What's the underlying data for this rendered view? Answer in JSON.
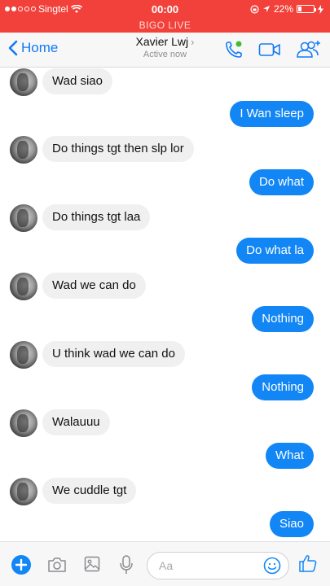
{
  "status_bar": {
    "carrier": "Singtel",
    "time": "00:00",
    "battery": "22%"
  },
  "live_banner": "BIGO LIVE",
  "nav": {
    "back_label": "Home",
    "contact_name": "Xavier Lwj",
    "status": "Active now"
  },
  "messages": [
    {
      "dir": "in",
      "text": "Wad siao"
    },
    {
      "dir": "out",
      "text": "I Wan sleep"
    },
    {
      "dir": "in",
      "text": "Do things tgt then slp lor"
    },
    {
      "dir": "out",
      "text": "Do what"
    },
    {
      "dir": "in",
      "text": "Do things tgt laa"
    },
    {
      "dir": "out",
      "text": "Do what la"
    },
    {
      "dir": "in",
      "text": "Wad we can do"
    },
    {
      "dir": "out",
      "text": "Nothing"
    },
    {
      "dir": "in",
      "text": "U think wad we can do"
    },
    {
      "dir": "out",
      "text": "Nothing"
    },
    {
      "dir": "in",
      "text": "Walauuu"
    },
    {
      "dir": "out",
      "text": "What"
    },
    {
      "dir": "in",
      "text": "We cuddle tgt"
    },
    {
      "dir": "out",
      "text": "Siao"
    }
  ],
  "composer": {
    "placeholder": "Aa"
  },
  "colors": {
    "status_red": "#f2413a",
    "messenger_blue": "#1286f5",
    "incoming_bubble": "#f0f0f0"
  }
}
